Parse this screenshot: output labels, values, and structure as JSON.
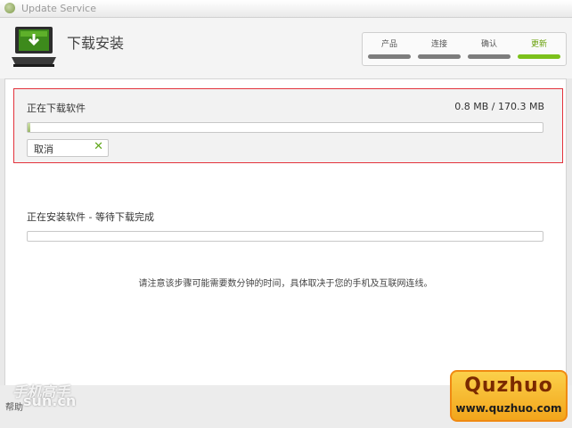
{
  "window": {
    "title": "Update Service"
  },
  "header": {
    "page_title": "下载安装",
    "steps": [
      {
        "label": "产品",
        "active": false
      },
      {
        "label": "连接",
        "active": false
      },
      {
        "label": "确认",
        "active": false
      },
      {
        "label": "更新",
        "active": true
      }
    ]
  },
  "download": {
    "label": "正在下载软件",
    "size_text": "0.8 MB / 170.3 MB",
    "progress": 0.005,
    "cancel_label": "取消"
  },
  "install": {
    "label": "正在安装软件 - 等待下载完成",
    "progress": 0
  },
  "note": "请注意该步骤可能需要数分钟的时间，具体取决于您的手机及互联网连线。",
  "footer": {
    "text": "帮助"
  },
  "watermarks": {
    "site_cn": "手机高手",
    "site_url": "sun.cn",
    "quzhuo_title": "Quzhuo",
    "quzhuo_url": "www.quzhuo.com"
  },
  "colors": {
    "accent": "#7cc11b",
    "highlight_border": "#e3323c",
    "step_inactive": "#7d7d7d"
  }
}
